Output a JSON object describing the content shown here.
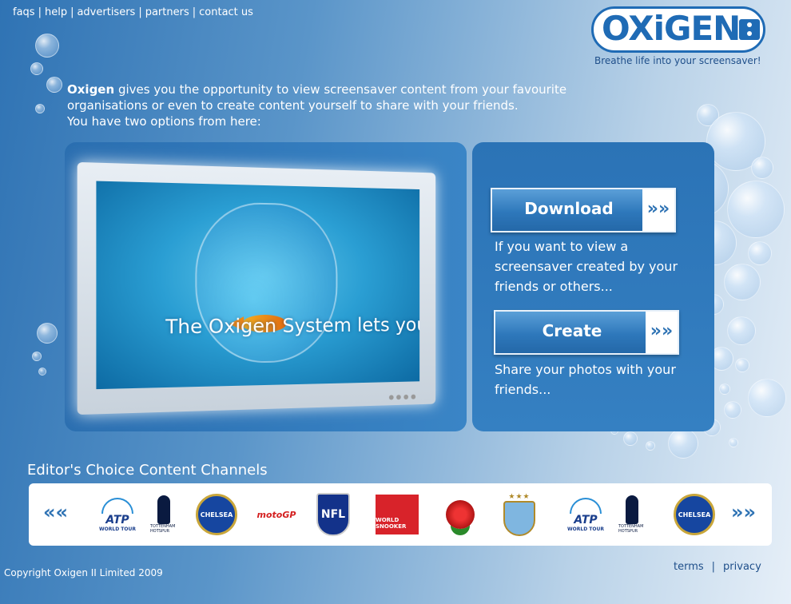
{
  "nav": {
    "items": [
      "faqs",
      "help",
      "advertisers",
      "partners",
      "contact us"
    ],
    "sep1": "|",
    "sep2": "|",
    "sep3": "|",
    "sep4": "|"
  },
  "logo": {
    "wordmark": "OXiGEN",
    "tagline": "Breathe life into your screensaver!"
  },
  "intro": {
    "brand": "Oxigen",
    "line1_rest": " gives you the opportunity to view screensaver content from your favourite",
    "line2": "organisations or even to create content yourself to share with your friends.",
    "line3": "You have two options from here:"
  },
  "hero": {
    "screen_text": "The Oxigen System lets you..."
  },
  "actions": {
    "download_label": "Download",
    "download_arrow": "»»",
    "download_desc": "If you want to view a screensaver created by your friends or others...",
    "create_label": "Create",
    "create_arrow": "»»",
    "create_desc": "Share your photos with your friends..."
  },
  "channels": {
    "title": "Editor's Choice Content Channels",
    "prev": "«",
    "next": "»",
    "logos": [
      {
        "name": "ATP World Tour",
        "text": "ATP",
        "sub": "WORLD TOUR"
      },
      {
        "name": "Tottenham Hotspur",
        "text": "TOTTENHAM HOTSPUR"
      },
      {
        "name": "Chelsea FC",
        "text": "CHELSEA"
      },
      {
        "name": "MotoGP",
        "text": "moto",
        "accent": "GP"
      },
      {
        "name": "NFL",
        "text": "NFL"
      },
      {
        "name": "World Snooker",
        "text": "WORLD SNOOKER"
      },
      {
        "name": "England Rugby"
      },
      {
        "name": "Manchester City",
        "stars": "★★★"
      },
      {
        "name": "ATP World Tour",
        "text": "ATP",
        "sub": "WORLD TOUR"
      },
      {
        "name": "Tottenham Hotspur",
        "text": "TOTTENHAM HOTSPUR"
      },
      {
        "name": "Chelsea FC",
        "text": "CHELSEA"
      }
    ]
  },
  "footer": {
    "copyright": "Copyright Oxigen II Limited 2009",
    "terms": "terms",
    "sep": "|",
    "privacy": "privacy"
  },
  "colors": {
    "brand_blue": "#1f6bb5",
    "panel_blue": "#2f78bb"
  }
}
